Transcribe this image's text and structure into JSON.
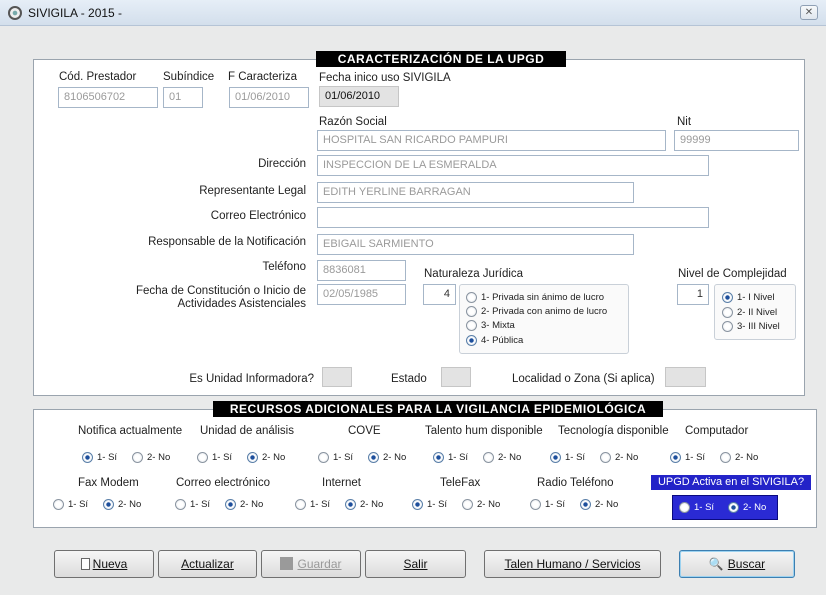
{
  "window": {
    "title": "SIVIGILA - 2015 -"
  },
  "upgd": {
    "section_title": "CARACTERIZACIÓN DE LA UPGD",
    "cod_prestador_label": "Cód. Prestador",
    "cod_prestador": "8106506702",
    "subindice_label": "Subíndice",
    "subindice": "01",
    "f_caracteriza_label": "F Caracteriza",
    "f_caracteriza": "01/06/2010",
    "fecha_inicio_label": "Fecha inico uso SIVIGILA",
    "fecha_inicio": "01/06/2010",
    "razon_social_label": "Razón Social",
    "razon_social": "HOSPITAL SAN RICARDO PAMPURI",
    "nit_label": "Nit",
    "nit": "99999",
    "direccion_label": "Dirección",
    "direccion": "INSPECCION DE LA ESMERALDA",
    "representante_label": "Representante Legal",
    "representante": "EDITH YERLINE BARRAGAN",
    "correo_label": "Correo Electrónico",
    "correo": "",
    "responsable_label": "Responsable de la Notificación",
    "responsable": "EBIGAIL SARMIENTO",
    "telefono_label": "Teléfono",
    "telefono": "8836081",
    "fecha_constitucion_label_1": "Fecha de Constitución o Inicio de",
    "fecha_constitucion_label_2": "Actividades Asistenciales",
    "fecha_constitucion": "02/05/1985",
    "naturaleza_label": "Naturaleza Jurídica",
    "naturaleza_value": "4",
    "naturaleza_options": [
      "1- Privada sin ánimo de lucro",
      "2- Privada con animo de lucro",
      "3- Mixta",
      "4- Pública"
    ],
    "naturaleza_selected": 3,
    "nivel_label": "Nivel de Complejidad",
    "nivel_value": "1",
    "nivel_options": [
      "1- I  Nivel",
      "2- II Nivel",
      "3- III Nivel"
    ],
    "nivel_selected": 0,
    "unidad_informadora_label": "Es Unidad Informadora?",
    "estado_label": "Estado",
    "localidad_label": "Localidad o Zona (Si aplica)"
  },
  "recursos": {
    "section_title": "RECURSOS ADICIONALES PARA LA VIGILANCIA EPIDEMIOLÓGICA",
    "si_label": "1- Sí",
    "no_label": "2- No",
    "groups": [
      {
        "label": "Notifica actualmente",
        "selected": "si"
      },
      {
        "label": "Unidad de análisis",
        "selected": "no"
      },
      {
        "label": "COVE",
        "selected": "no"
      },
      {
        "label": "Talento hum disponible",
        "selected": "si"
      },
      {
        "label": "Tecnología disponible",
        "selected": "si"
      },
      {
        "label": "Computador",
        "selected": "si"
      },
      {
        "label": "Fax Modem",
        "selected": "no"
      },
      {
        "label": "Correo electrónico",
        "selected": "no"
      },
      {
        "label": "Internet",
        "selected": "no"
      },
      {
        "label": "TeleFax",
        "selected": "si"
      },
      {
        "label": "Radio Teléfono",
        "selected": "no"
      }
    ],
    "activa": {
      "label": "UPGD Activa en el SIVIGILA?",
      "selected": "no"
    }
  },
  "buttons": {
    "nueva": "Nueva",
    "actualizar": "Actualizar",
    "guardar": "Guardar",
    "salir": "Salir",
    "talento": "Talen Humano / Servicios",
    "buscar": "Buscar"
  }
}
